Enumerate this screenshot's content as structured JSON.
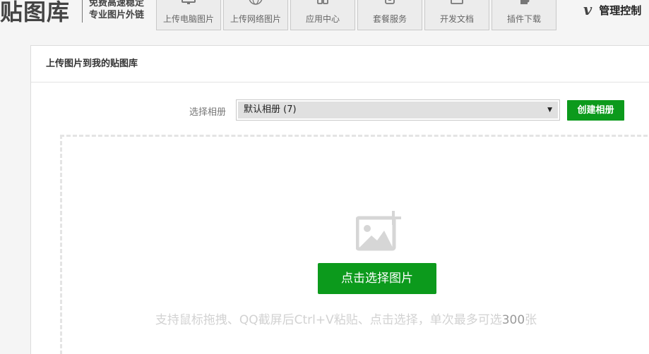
{
  "header": {
    "logo_text": "贴图库",
    "slogan_line1": "免费高速稳定",
    "slogan_line2": "专业图片外链",
    "nav": [
      {
        "label": "上传电脑图片",
        "icon": "monitor-icon"
      },
      {
        "label": "上传网络图片",
        "icon": "globe-icon"
      },
      {
        "label": "应用中心",
        "icon": "apps-icon"
      },
      {
        "label": "套餐服务",
        "icon": "package-icon"
      },
      {
        "label": "开发文档",
        "icon": "document-icon"
      },
      {
        "label": "插件下载",
        "icon": "puzzle-icon"
      }
    ],
    "admin_icon_text": "v",
    "admin_label": "管理控制"
  },
  "panel": {
    "title": "上传图片到我的贴图库",
    "album_label": "选择相册",
    "album_selected": "默认相册 (7)",
    "create_album_label": "创建相册",
    "pick_button_label": "点击选择图片",
    "hint_prefix": "支持鼠标拖拽、QQ截屏后Ctrl+V粘贴、点击选择，单次最多可选",
    "hint_number": "300",
    "hint_suffix": "张"
  },
  "colors": {
    "accent_green": "#0c9a1c",
    "page_bg": "#f5f5f5",
    "hint_text": "#d2d2d2"
  }
}
